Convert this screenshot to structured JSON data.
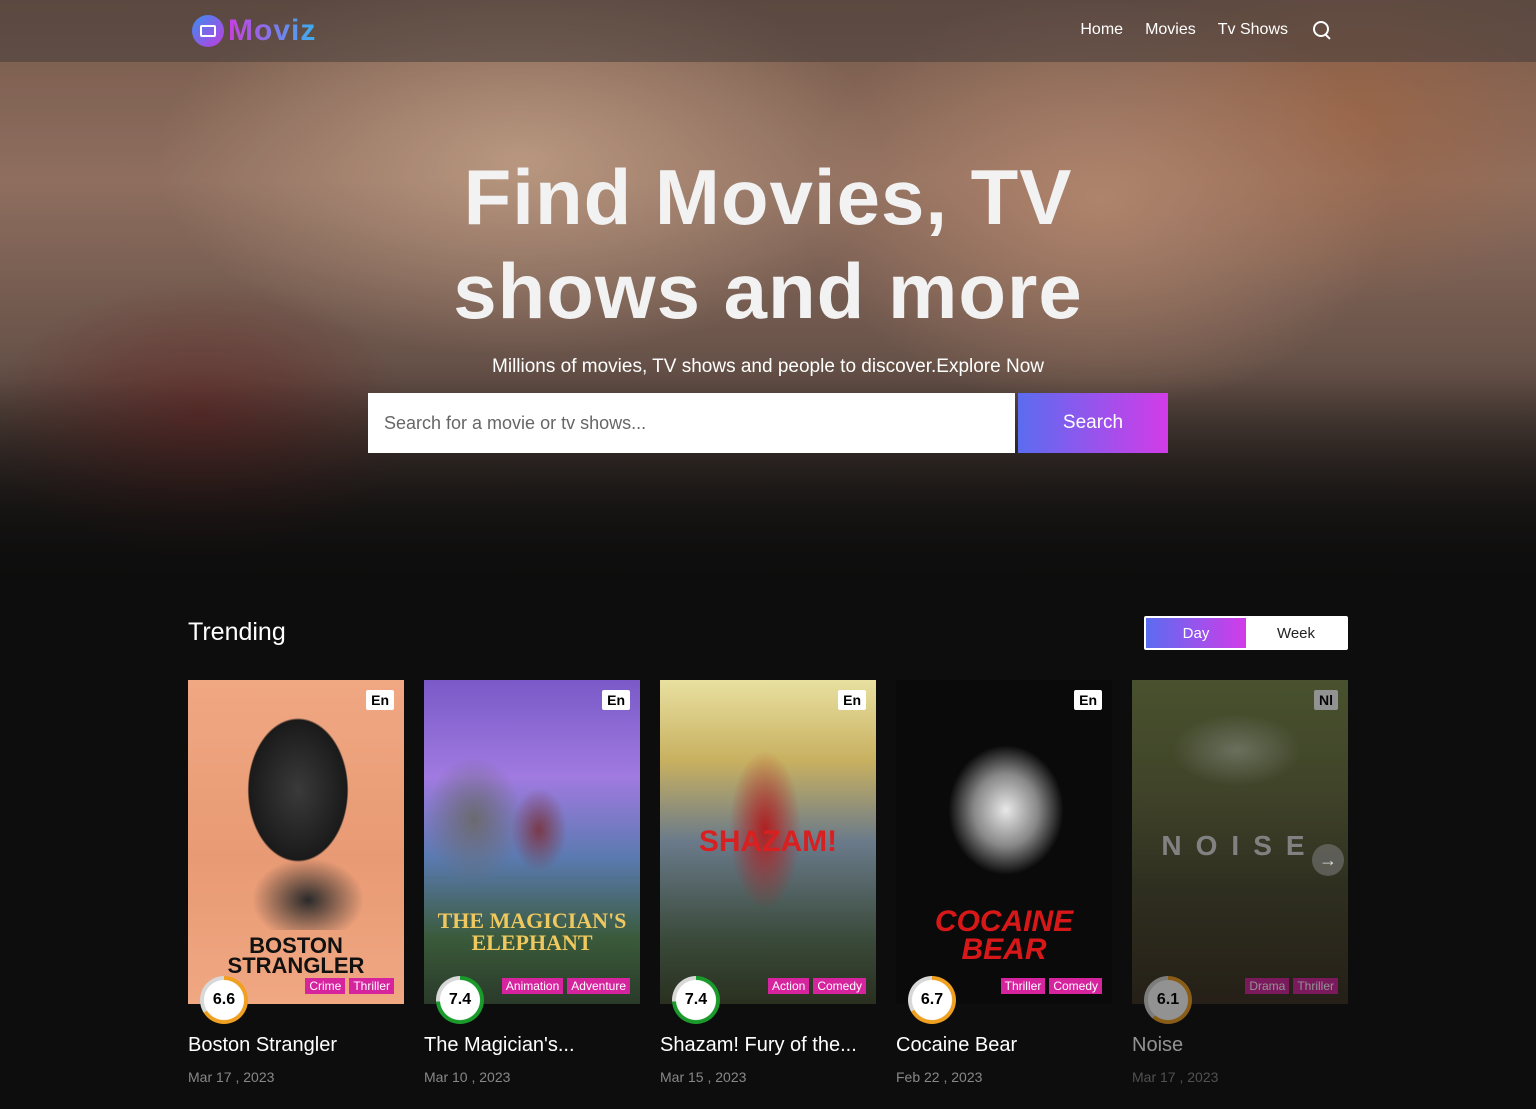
{
  "header": {
    "logo_text": "Moviz",
    "nav": [
      "Home",
      "Movies",
      "Tv Shows"
    ]
  },
  "hero": {
    "title_line1": "Find Movies, TV",
    "title_line2": "shows and more",
    "subtitle": "Millions of movies, TV shows and people to discover.Explore Now",
    "search_placeholder": "Search for a movie or tv shows...",
    "search_button": "Search"
  },
  "trending": {
    "title": "Trending",
    "toggle": [
      "Day",
      "Week"
    ],
    "active_toggle": "Day",
    "items": [
      {
        "title": "Boston Strangler",
        "date": "Mar 17 , 2023",
        "rating": "6.6",
        "rating_value": 0.66,
        "rating_color": "#f0a020",
        "lang": "En",
        "genres": [
          "Crime",
          "Thriller"
        ],
        "poster_text": "BOSTON STRANGLER"
      },
      {
        "title": "The Magician's...",
        "date": "Mar 10 , 2023",
        "rating": "7.4",
        "rating_value": 0.74,
        "rating_color": "#1a9a2a",
        "lang": "En",
        "genres": [
          "Animation",
          "Adventure"
        ],
        "poster_text": "THE MAGICIAN'S ELEPHANT"
      },
      {
        "title": "Shazam! Fury of the...",
        "date": "Mar 15 , 2023",
        "rating": "7.4",
        "rating_value": 0.74,
        "rating_color": "#1a9a2a",
        "lang": "En",
        "genres": [
          "Action",
          "Comedy"
        ],
        "poster_text": "SHAZAM!"
      },
      {
        "title": "Cocaine Bear",
        "date": "Feb 22 , 2023",
        "rating": "6.7",
        "rating_value": 0.67,
        "rating_color": "#f0a020",
        "lang": "En",
        "genres": [
          "Thriller",
          "Comedy"
        ],
        "poster_text": "COCAINE BEAR"
      },
      {
        "title": "Noise",
        "date": "Mar 17 , 2023",
        "rating": "6.1",
        "rating_value": 0.61,
        "rating_color": "#f0a020",
        "lang": "Nl",
        "genres": [
          "Drama",
          "Thriller"
        ],
        "poster_text": "NOISE"
      }
    ]
  }
}
